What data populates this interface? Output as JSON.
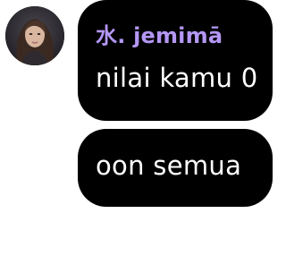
{
  "messages": [
    {
      "sender": "水. jemimā",
      "text": "nilai kamu 0"
    },
    {
      "text": "oon semua"
    }
  ],
  "colors": {
    "bubble_bg": "#000000",
    "message_text": "#ffffff",
    "sender_name": "#b497f5",
    "page_bg": "#ffffff"
  },
  "avatar": {
    "icon": "profile-photo"
  }
}
